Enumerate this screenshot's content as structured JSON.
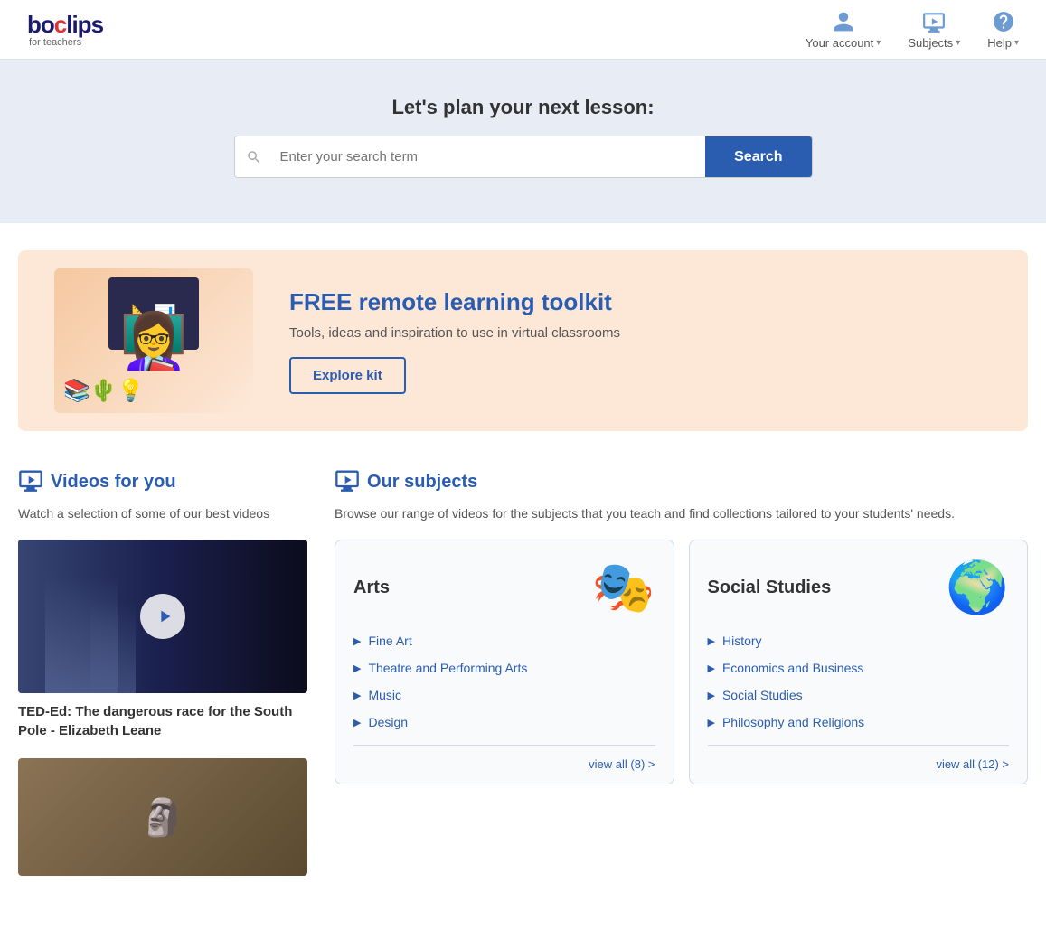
{
  "header": {
    "logo": {
      "text": "boclips",
      "sub": "for teachers"
    },
    "nav": [
      {
        "id": "your-account",
        "label": "Your account",
        "icon": "person-icon",
        "has_chevron": true
      },
      {
        "id": "subjects",
        "label": "Subjects",
        "icon": "monitor-icon",
        "has_chevron": true
      },
      {
        "id": "help",
        "label": "Help",
        "icon": "help-icon",
        "has_chevron": true
      }
    ]
  },
  "hero": {
    "title": "Let's plan your next lesson:",
    "search_placeholder": "Enter your search term",
    "search_button": "Search"
  },
  "banner": {
    "title": "FREE remote learning toolkit",
    "subtitle": "Tools, ideas and inspiration to use in virtual classrooms",
    "explore_button": "Explore kit"
  },
  "videos_section": {
    "title": "Videos for you",
    "description": "Watch a selection of some of our best videos",
    "videos": [
      {
        "id": "video-1",
        "title": "TED-Ed: The dangerous race for the South Pole - Elizabeth Leane"
      },
      {
        "id": "video-2",
        "title": ""
      }
    ]
  },
  "subjects_section": {
    "title": "Our subjects",
    "description": "Browse our range of videos for the subjects that you teach and find collections tailored to your students' needs.",
    "cards": [
      {
        "id": "arts",
        "title": "Arts",
        "icon": "🎭",
        "links": [
          "Fine Art",
          "Theatre and Performing Arts",
          "Music",
          "Design"
        ],
        "view_all": "view all (8) >"
      },
      {
        "id": "social-studies",
        "title": "Social Studies",
        "icon": "🌍",
        "links": [
          "History",
          "Economics and Business",
          "Social Studies",
          "Philosophy and Religions"
        ],
        "view_all": "view all (12) >"
      }
    ]
  }
}
